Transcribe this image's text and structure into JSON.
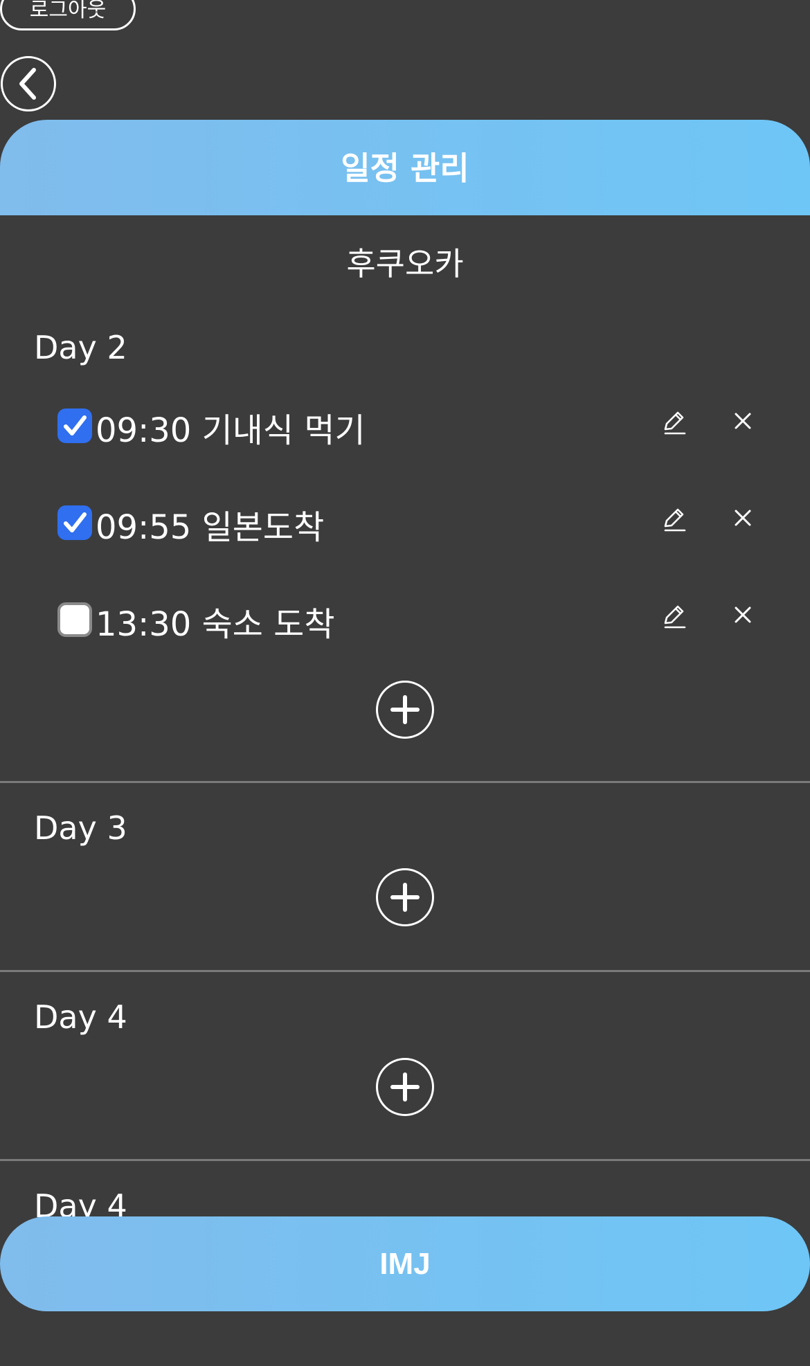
{
  "logout_label": "로그아웃",
  "header": {
    "title": "일정 관리"
  },
  "trip": {
    "title": "후쿠오카"
  },
  "days": [
    {
      "title": "Day 2",
      "tasks": [
        {
          "text": "09:30 기내식 먹기",
          "checked": true
        },
        {
          "text": "09:55 일본도착",
          "checked": true
        },
        {
          "text": "13:30 숙소 도착",
          "checked": false
        }
      ]
    },
    {
      "title": "Day 3",
      "tasks": []
    },
    {
      "title": "Day 4",
      "tasks": []
    },
    {
      "title": "Day 4",
      "tasks": []
    }
  ],
  "footer": {
    "label": "IMJ"
  },
  "icons": {
    "back": "chevron-left-icon",
    "edit": "pencil-icon",
    "delete": "close-icon",
    "add": "plus-circle-icon",
    "check": "check-icon"
  },
  "colors": {
    "background": "#3c3c3c",
    "accent_gradient_start": "#80bcec",
    "accent_gradient_end": "#6ec6f6",
    "checkbox_checked": "#2f6ff0",
    "divider": "#7a7a7a"
  }
}
